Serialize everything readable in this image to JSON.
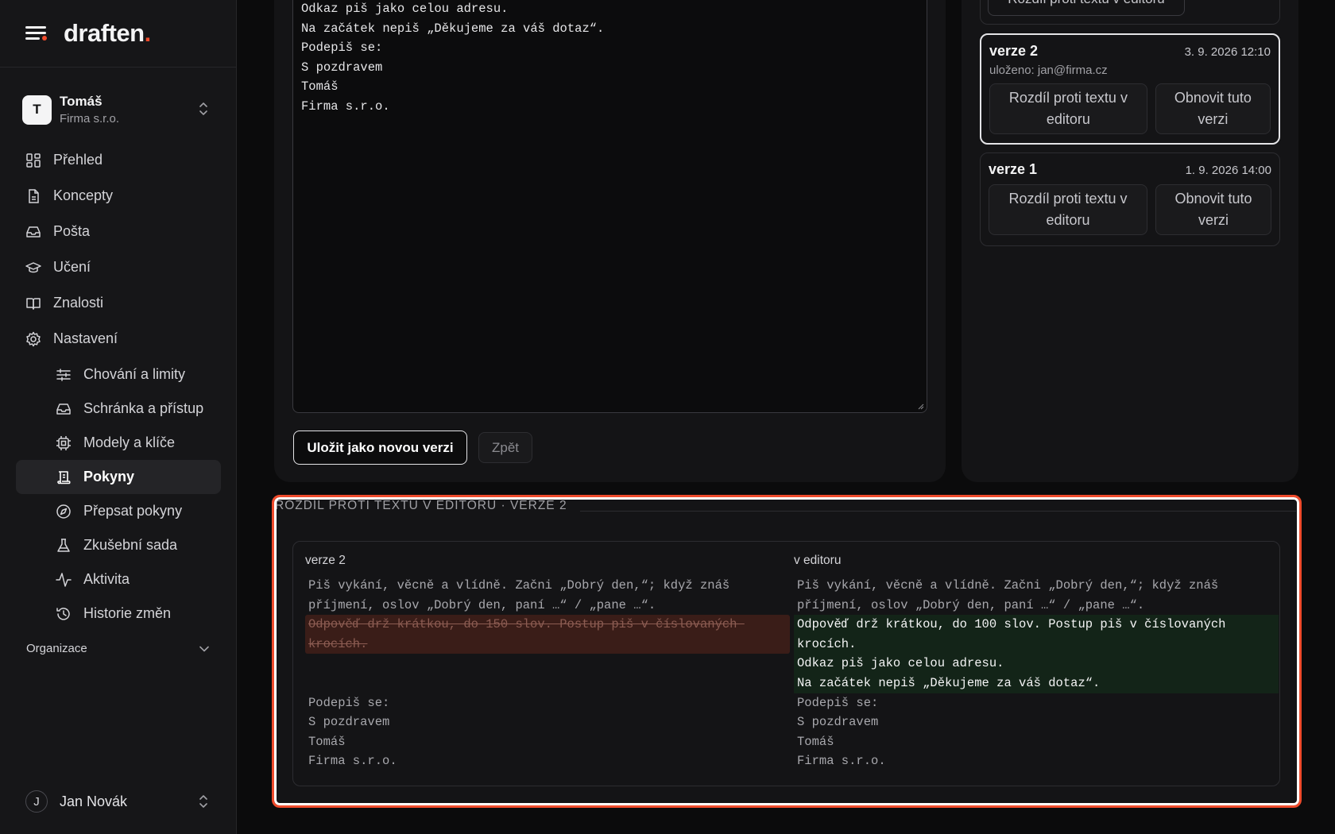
{
  "brand": {
    "name_main": "draften",
    "name_dot": "."
  },
  "workspace": {
    "initial": "T",
    "name": "Tomáš",
    "org": "Firma s.r.o."
  },
  "nav": {
    "items": [
      {
        "label": "Přehled",
        "icon": "dashboard-icon"
      },
      {
        "label": "Koncepty",
        "icon": "file-icon"
      },
      {
        "label": "Pošta",
        "icon": "inbox-icon"
      },
      {
        "label": "Učení",
        "icon": "graduation-cap-icon"
      },
      {
        "label": "Znalosti",
        "icon": "book-icon"
      },
      {
        "label": "Nastavení",
        "icon": "gear-icon"
      }
    ],
    "sub_items": [
      {
        "label": "Chování a limity",
        "icon": "sliders-icon"
      },
      {
        "label": "Schránka a přístup",
        "icon": "inbox-icon"
      },
      {
        "label": "Modely a klíče",
        "icon": "chip-icon"
      },
      {
        "label": "Pokyny",
        "icon": "scroll-icon",
        "active": true
      },
      {
        "label": "Přepsat pokyny",
        "icon": "compass-icon"
      },
      {
        "label": "Zkušební sada",
        "icon": "flask-icon"
      },
      {
        "label": "Aktivita",
        "icon": "activity-icon"
      },
      {
        "label": "Historie změn",
        "icon": "history-icon"
      }
    ],
    "org_section": "Organizace"
  },
  "user": {
    "initial": "J",
    "name": "Jan Novák"
  },
  "editor": {
    "lines": [
      "Odkaz piš jako celou adresu.",
      "Na začátek nepiš „Děkujeme za váš dotaz“.",
      "Podepiš se:",
      "S pozdravem",
      "Tomáš",
      "Firma s.r.o."
    ],
    "save_label": "Uložit jako novou verzi",
    "back_label": "Zpět"
  },
  "versions": {
    "top_cut_label": "Rozdíl proti textu v editoru",
    "list": [
      {
        "name": "verze 2",
        "date": "3. 9. 2026 12:10",
        "saved_by": "uloženo: jan@firma.cz",
        "diff_label": "Rozdíl proti textu v editoru",
        "restore_label": "Obnovit tuto verzi"
      },
      {
        "name": "verze 1",
        "date": "1. 9. 2026 14:00",
        "diff_label": "Rozdíl proti textu v editoru",
        "restore_label": "Obnovit tuto verzi"
      }
    ]
  },
  "diff": {
    "title": "ROZDÍL PROTI TEXTU V EDITORU · VERZE 2",
    "left_label": "verze 2",
    "right_label": "v editoru",
    "left_lines": [
      "Piš vykání, věcně a vlídně. Začni „Dobrý den,“; když znáš příjmení, oslov „Dobrý den, paní …“ / „pane …“.",
      "Odpověď drž krátkou, do 150 slov. Postup piš v číslovaných krocích.",
      "Podepiš se:",
      "S pozdravem",
      "Tomáš",
      "Firma s.r.o."
    ],
    "right_lines": [
      "Piš vykání, věcně a vlídně. Začni „Dobrý den,“; když znáš příjmení, oslov „Dobrý den, paní …“ / „pane …“.",
      "Odpověď drž krátkou, do 100 slov. Postup piš v číslovaných krocích.",
      "Odkaz piš jako celou adresu.",
      "Na začátek nepiš „Děkujeme za váš dotaz“.",
      "Podepiš se:",
      "S pozdravem",
      "Tomáš",
      "Firma s.r.o."
    ]
  },
  "colors": {
    "accent": "#ef4b2c",
    "deleted_bg": "#3a1d18",
    "added_bg": "#132418"
  }
}
